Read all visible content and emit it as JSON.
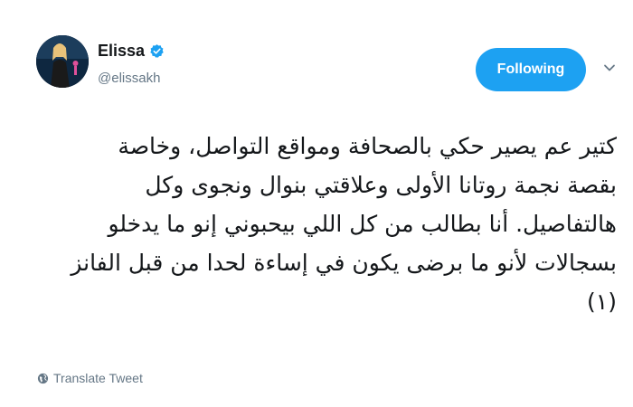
{
  "user": {
    "name": "Elissa",
    "handle": "@elissakh",
    "verified": true,
    "avatar_icon": "profile-photo"
  },
  "follow_button": {
    "label": "Following",
    "color": "#1da1f2"
  },
  "menu": {
    "icon": "chevron-down-icon"
  },
  "tweet": {
    "lines": [
      "كتير عم يصير حكي بالصحافة ومواقع التواصل، وخاصة",
      "بقصة نجمة روتانا الأولى وعلاقتي بنوال ونجوى وكل",
      "هالتفاصيل. أنا بطالب من كل اللي بيحبوني إنو ما يدخلو",
      "بسجالات لأنو ما برضى يكون في إساءة لحدا من قبل الفانز",
      "(١)"
    ]
  },
  "translate": {
    "label": "Translate Tweet",
    "icon": "globe-icon"
  }
}
